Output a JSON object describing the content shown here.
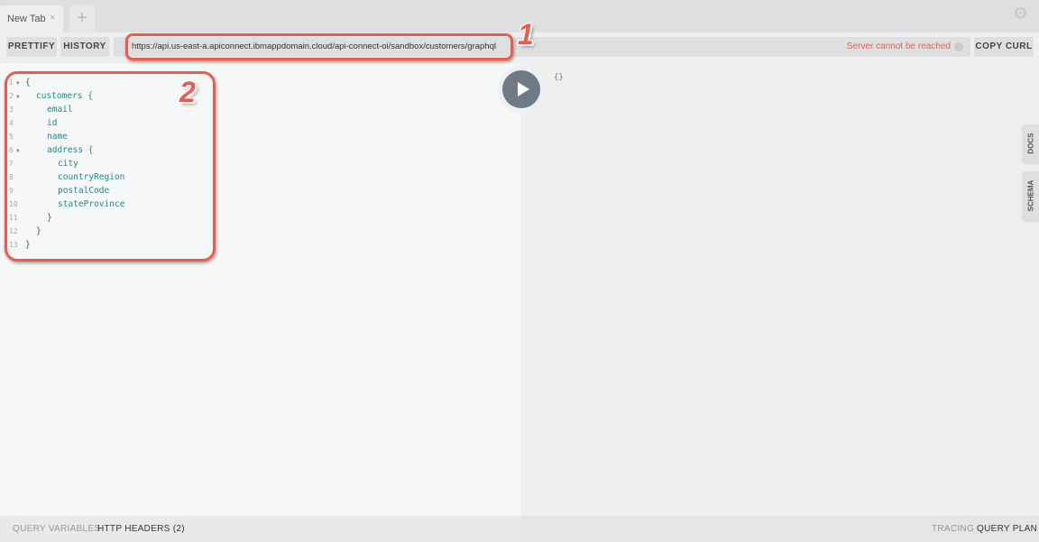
{
  "tabs": [
    {
      "label": "New Tab",
      "close": "×"
    }
  ],
  "add_tab": "+",
  "toolbar": {
    "prettify": "PRETTIFY",
    "history": "HISTORY",
    "url": "https://api.us-east-a.apiconnect.ibmappdomain.cloud/api-connect-oi/sandbox/customers/graphql",
    "status": "Server cannot be reached",
    "copy_curl": "COPY CURL"
  },
  "editor": {
    "lines": [
      {
        "n": "1",
        "fold": true,
        "indent": 0,
        "text": "{",
        "kw": false
      },
      {
        "n": "2",
        "fold": true,
        "indent": 1,
        "text": "customers {",
        "kw": true
      },
      {
        "n": "3",
        "fold": false,
        "indent": 2,
        "text": "email",
        "kw": true
      },
      {
        "n": "4",
        "fold": false,
        "indent": 2,
        "text": "id",
        "kw": true
      },
      {
        "n": "5",
        "fold": false,
        "indent": 2,
        "text": "name",
        "kw": true
      },
      {
        "n": "6",
        "fold": true,
        "indent": 2,
        "text": "address {",
        "kw": true
      },
      {
        "n": "7",
        "fold": false,
        "indent": 3,
        "text": "city",
        "kw": true
      },
      {
        "n": "8",
        "fold": false,
        "indent": 3,
        "text": "countryRegion",
        "kw": true
      },
      {
        "n": "9",
        "fold": false,
        "indent": 3,
        "text": "postalCode",
        "kw": true
      },
      {
        "n": "10",
        "fold": false,
        "indent": 3,
        "text": "stateProvince",
        "kw": true
      },
      {
        "n": "11",
        "fold": false,
        "indent": 2,
        "text": "}",
        "kw": false
      },
      {
        "n": "12",
        "fold": false,
        "indent": 1,
        "text": "}",
        "kw": false
      },
      {
        "n": "13",
        "fold": false,
        "indent": 0,
        "text": "}",
        "kw": false
      }
    ]
  },
  "result": "{}",
  "side_tabs": {
    "docs": "DOCS",
    "schema": "SCHEMA"
  },
  "bottom": {
    "query_variables": "QUERY VARIABLES",
    "http_headers": "HTTP HEADERS (2)",
    "tracing": "TRACING",
    "query_plan": "QUERY PLAN"
  },
  "annotations": {
    "one": "1",
    "two": "2"
  },
  "colors": {
    "accent": "#ef5a4f",
    "error": "#f25c54",
    "keyword": "#1f8c8a"
  }
}
